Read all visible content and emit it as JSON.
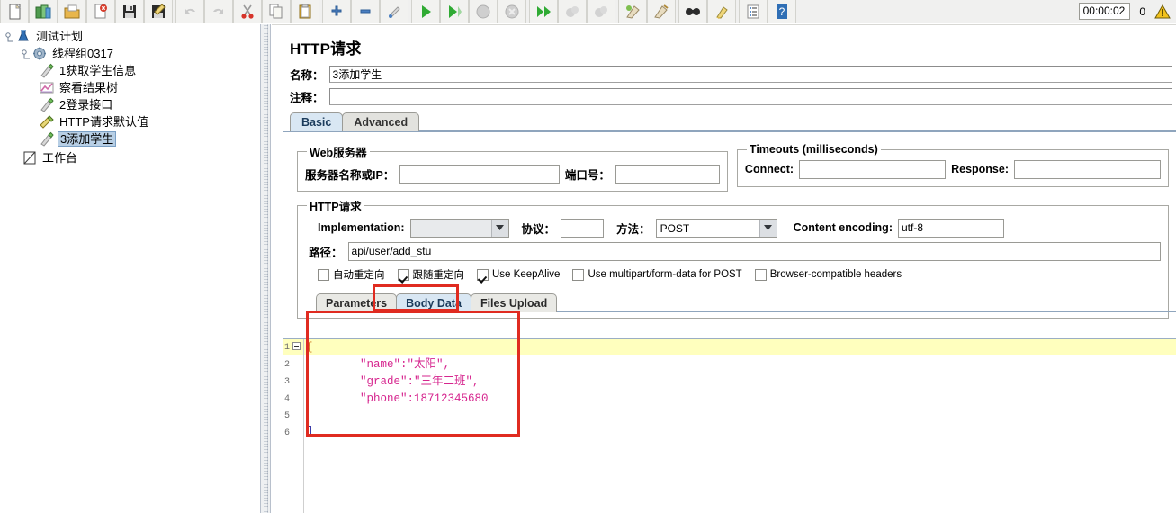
{
  "toolbar": {
    "buttons": [
      {
        "name": "new-test-plan-icon",
        "title": "New"
      },
      {
        "name": "templates-icon",
        "title": "Templates"
      },
      {
        "name": "open-icon",
        "title": "Open"
      },
      {
        "name": "close-icon",
        "title": "Close"
      },
      {
        "name": "save-icon",
        "title": "Save"
      },
      {
        "name": "save-as-icon",
        "title": "Save Test Plan as"
      },
      {
        "name": "undo-icon",
        "title": "Undo"
      },
      {
        "name": "redo-icon",
        "title": "Redo"
      },
      {
        "name": "cut-icon",
        "title": "Cut"
      },
      {
        "name": "copy-icon",
        "title": "Copy"
      },
      {
        "name": "paste-icon",
        "title": "Paste"
      },
      {
        "name": "expand-all-icon",
        "title": "Expand All"
      },
      {
        "name": "collapse-all-icon",
        "title": "Collapse All"
      },
      {
        "name": "toggle-icon",
        "title": "Toggle"
      },
      {
        "name": "start-icon",
        "title": "Start"
      },
      {
        "name": "start-no-pauses-icon",
        "title": "Start no pauses"
      },
      {
        "name": "stop-icon",
        "title": "Stop"
      },
      {
        "name": "shutdown-icon",
        "title": "Shutdown"
      },
      {
        "name": "remote-start-all-icon",
        "title": "Remote Start All"
      },
      {
        "name": "remote-stop-all-icon",
        "title": "Remote Stop All"
      },
      {
        "name": "remote-shutdown-all-icon",
        "title": "Remote Shutdown All"
      },
      {
        "name": "clear-icon",
        "title": "Clear"
      },
      {
        "name": "clear-all-icon",
        "title": "Clear All"
      },
      {
        "name": "search-icon",
        "title": "Search"
      },
      {
        "name": "reset-search-icon",
        "title": "Reset Search"
      },
      {
        "name": "function-helper-icon",
        "title": "Function Helper Dialog"
      },
      {
        "name": "help-icon",
        "title": "Help"
      }
    ],
    "timer": "00:00:02",
    "error_count": "0",
    "warning_icon": "warning-triangle-icon"
  },
  "tree": {
    "nodes": [
      {
        "label": "测试计划",
        "icon": "test-plan-icon",
        "depth": 0,
        "selected": false,
        "handle": true,
        "expanded": true
      },
      {
        "label": "线程组0317",
        "icon": "thread-group-icon",
        "depth": 1,
        "selected": false,
        "handle": true,
        "expanded": true
      },
      {
        "label": "1获取学生信息",
        "icon": "http-sampler-icon",
        "depth": 2,
        "selected": false,
        "handle": false
      },
      {
        "label": "察看结果树",
        "icon": "view-results-tree-icon",
        "depth": 2,
        "selected": false,
        "handle": false
      },
      {
        "label": "2登录接口",
        "icon": "http-sampler-icon",
        "depth": 2,
        "selected": false,
        "handle": false
      },
      {
        "label": "HTTP请求默认值",
        "icon": "http-defaults-icon",
        "depth": 2,
        "selected": false,
        "handle": false
      },
      {
        "label": "3添加学生",
        "icon": "http-sampler-icon",
        "depth": 2,
        "selected": true,
        "handle": false
      },
      {
        "label": "工作台",
        "icon": "workbench-icon",
        "depth": 0,
        "selected": false,
        "handle": false
      }
    ]
  },
  "main": {
    "title": "HTTP请求",
    "name_label": "名称：",
    "name_value": "3添加学生",
    "comment_label": "注释：",
    "comment_value": "",
    "tabs": [
      {
        "label": "Basic",
        "active": true
      },
      {
        "label": "Advanced",
        "active": false
      }
    ],
    "web_server": {
      "legend": "Web服务器",
      "server_label": "服务器名称或IP：",
      "server_value": "",
      "port_label": "端口号：",
      "port_value": ""
    },
    "timeouts": {
      "legend": "Timeouts (milliseconds)",
      "connect_label": "Connect:",
      "connect_value": "",
      "response_label": "Response:",
      "response_value": ""
    },
    "http_request": {
      "legend": "HTTP请求",
      "implementation_label": "Implementation:",
      "implementation_value": "",
      "protocol_label": "协议：",
      "protocol_value": "",
      "method_label": "方法：",
      "method_value": "POST",
      "content_encoding_label": "Content encoding:",
      "content_encoding_value": "utf-8",
      "path_label": "路径：",
      "path_value": "api/user/add_stu",
      "checkboxes": [
        {
          "label": "自动重定向",
          "checked": false
        },
        {
          "label": "跟随重定向",
          "checked": true
        },
        {
          "label": "Use KeepAlive",
          "checked": true
        },
        {
          "label": "Use multipart/form-data for POST",
          "checked": false
        },
        {
          "label": "Browser-compatible headers",
          "checked": false
        }
      ],
      "inner_tabs": [
        {
          "label": "Parameters",
          "active": false
        },
        {
          "label": "Body Data",
          "active": true
        },
        {
          "label": "Files Upload",
          "active": false
        }
      ],
      "body_data": {
        "lines": [
          {
            "n": "1",
            "text": "{",
            "type": "brace",
            "highlight": true,
            "fold": true
          },
          {
            "n": "2",
            "text": "        \"name\":\"太阳\",",
            "type": "json"
          },
          {
            "n": "3",
            "text": "        \"grade\":\"三年二班\",",
            "type": "json"
          },
          {
            "n": "4",
            "text": "        \"phone\":18712345680",
            "type": "json"
          },
          {
            "n": "5",
            "text": "",
            "type": "json"
          },
          {
            "n": "6",
            "text": "}",
            "type": "brace",
            "caret": true
          }
        ]
      }
    }
  },
  "colors": {
    "annotation": "#e02b20",
    "selection": "#b8cfe5",
    "tab_active": "#d9e7f3",
    "code_text": "#d6258e",
    "code_brace": "#cf7a22",
    "highlight_line": "#ffffbe"
  }
}
